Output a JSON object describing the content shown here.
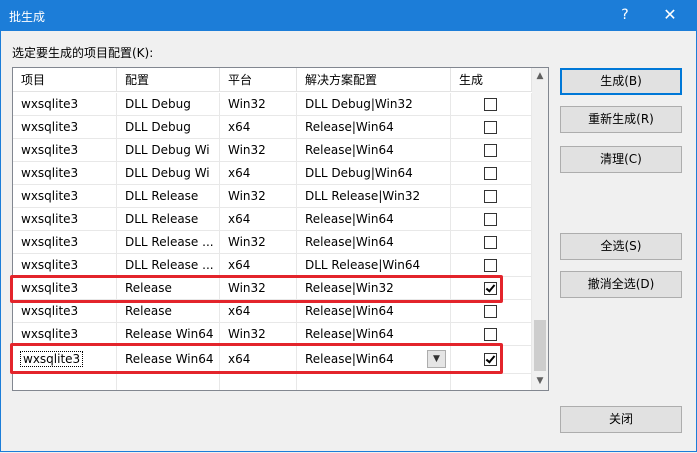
{
  "window": {
    "title": "批生成",
    "help_glyph": "?",
    "close_glyph": "✕"
  },
  "prompt": "选定要生成的项目配置(K):",
  "columns": [
    "项目",
    "配置",
    "平台",
    "解决方案配置",
    "生成"
  ],
  "rows": [
    {
      "project": "wxsqlite3",
      "config": "DLL Debug",
      "platform": "Win32",
      "solution": "DLL Debug|Win32",
      "build": false
    },
    {
      "project": "wxsqlite3",
      "config": "DLL Debug",
      "platform": "x64",
      "solution": "Release|Win64",
      "build": false
    },
    {
      "project": "wxsqlite3",
      "config": "DLL Debug Wi",
      "platform": "Win32",
      "solution": "Release|Win64",
      "build": false
    },
    {
      "project": "wxsqlite3",
      "config": "DLL Debug Wi",
      "platform": "x64",
      "solution": "DLL Debug|Win64",
      "build": false
    },
    {
      "project": "wxsqlite3",
      "config": "DLL Release",
      "platform": "Win32",
      "solution": "DLL Release|Win32",
      "build": false
    },
    {
      "project": "wxsqlite3",
      "config": "DLL Release",
      "platform": "x64",
      "solution": "Release|Win64",
      "build": false
    },
    {
      "project": "wxsqlite3",
      "config": "DLL Release ...",
      "platform": "Win32",
      "solution": "Release|Win64",
      "build": false
    },
    {
      "project": "wxsqlite3",
      "config": "DLL Release ...",
      "platform": "x64",
      "solution": "DLL Release|Win64",
      "build": false
    },
    {
      "project": "wxsqlite3",
      "config": "Release",
      "platform": "Win32",
      "solution": "Release|Win32",
      "build": true
    },
    {
      "project": "wxsqlite3",
      "config": "Release",
      "platform": "x64",
      "solution": "Release|Win64",
      "build": false
    },
    {
      "project": "wxsqlite3",
      "config": "Release Win64",
      "platform": "Win32",
      "solution": "Release|Win64",
      "build": false
    },
    {
      "project": "wxsqlite3",
      "config": "Release Win64",
      "platform": "x64",
      "solution": "Release|Win64",
      "build": true
    }
  ],
  "scroll": {
    "up_glyph": "▲",
    "down_glyph": "▼",
    "dropdown_glyph": "▼"
  },
  "buttons": {
    "build": "生成(B)",
    "rebuild": "重新生成(R)",
    "clean": "清理(C)",
    "select_all": "全选(S)",
    "deselect_all": "撤消全选(D)",
    "close": "关闭"
  }
}
